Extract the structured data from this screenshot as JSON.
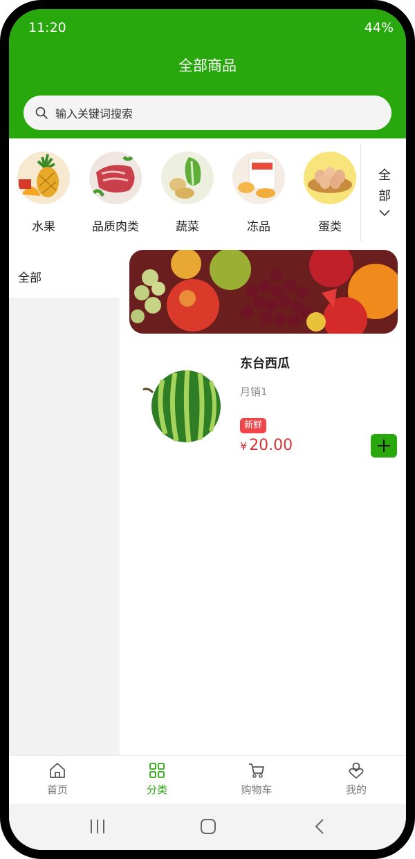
{
  "status_bar": {
    "time": "11:20",
    "battery": "44%"
  },
  "header": {
    "title": "全部商品"
  },
  "search": {
    "placeholder": "输入关键词搜索",
    "icon": "search-icon"
  },
  "categories": [
    {
      "label": "水果",
      "icon": "fruit-image"
    },
    {
      "label": "品质肉类",
      "icon": "meat-image"
    },
    {
      "label": "蔬菜",
      "icon": "vegetable-image"
    },
    {
      "label": "冻品",
      "icon": "frozen-food-image"
    },
    {
      "label": "蛋类",
      "icon": "eggs-image"
    }
  ],
  "category_expand": {
    "label_line1": "全",
    "label_line2": "部",
    "icon": "chevron-down-icon"
  },
  "sidebar": {
    "items": [
      {
        "label": "全部",
        "active": true
      }
    ]
  },
  "products": [
    {
      "name": "东台西瓜",
      "sales": "月销1",
      "tag": "新鲜",
      "currency": "¥",
      "price": "20.00"
    }
  ],
  "tabbar": {
    "items": [
      {
        "label": "首页",
        "icon": "home-icon"
      },
      {
        "label": "分类",
        "icon": "grid-icon",
        "active": true
      },
      {
        "label": "购物车",
        "icon": "cart-icon"
      },
      {
        "label": "我的",
        "icon": "user-icon"
      }
    ]
  },
  "colors": {
    "primary": "#29a80e",
    "price": "#d33434",
    "tag": "#f2454a",
    "sidebar_bg": "#f2f2f2"
  }
}
